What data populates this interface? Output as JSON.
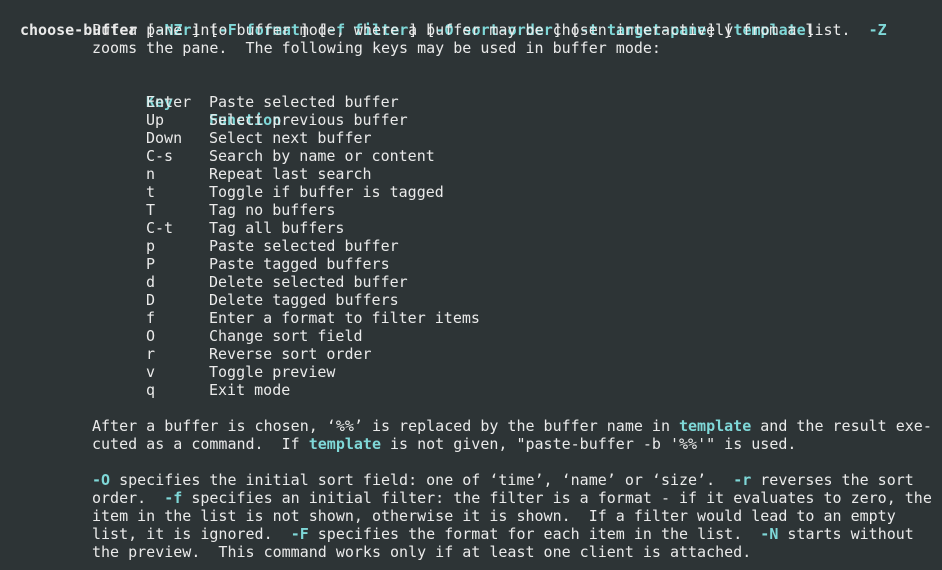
{
  "synopsis": {
    "command": "choose-buffer",
    "b1": " [",
    "flags_nzr": "-NZr",
    "b2": "] [",
    "flag_f": "-F",
    "sp1": " ",
    "arg_format": "format",
    "b3": "] [",
    "flag_f2": "-f",
    "sp2": " ",
    "arg_filter": "filter",
    "b4": "] [",
    "flag_o": "-O",
    "sp3": " ",
    "arg_sort": "sort-order",
    "b5": "] [",
    "flag_t": "-t",
    "sp4": " ",
    "arg_target": "target-pane",
    "b6": "] [",
    "arg_template": "template",
    "b7": "]"
  },
  "intro": {
    "line1_a": "Put a pane into buffer mode, where a buffer may be chosen interactively from a list.  ",
    "line1_z": "-Z",
    "line2": "zooms the pane.  The following keys may be used in buffer mode:"
  },
  "table": {
    "header_key": "Key",
    "header_function": "Function",
    "rows": [
      {
        "key": "Enter",
        "function": "Paste selected buffer"
      },
      {
        "key": "Up",
        "function": "Select previous buffer"
      },
      {
        "key": "Down",
        "function": "Select next buffer"
      },
      {
        "key": "C-s",
        "function": "Search by name or content"
      },
      {
        "key": "n",
        "function": "Repeat last search"
      },
      {
        "key": "t",
        "function": "Toggle if buffer is tagged"
      },
      {
        "key": "T",
        "function": "Tag no buffers"
      },
      {
        "key": "C-t",
        "function": "Tag all buffers"
      },
      {
        "key": "p",
        "function": "Paste selected buffer"
      },
      {
        "key": "P",
        "function": "Paste tagged buffers"
      },
      {
        "key": "d",
        "function": "Delete selected buffer"
      },
      {
        "key": "D",
        "function": "Delete tagged buffers"
      },
      {
        "key": "f",
        "function": "Enter a format to filter items"
      },
      {
        "key": "O",
        "function": "Change sort field"
      },
      {
        "key": "r",
        "function": "Reverse sort order"
      },
      {
        "key": "v",
        "function": "Toggle preview"
      },
      {
        "key": "q",
        "function": "Exit mode"
      }
    ]
  },
  "para1": {
    "l1_a": "After a buffer is chosen, ‘%%’ is replaced by the buffer name in ",
    "l1_template": "template",
    "l1_b": " and the result exe-",
    "l2_a": "cuted as a command.  If ",
    "l2_template": "template",
    "l2_b": " is not given, \"paste-buffer -b '%%'\" is used."
  },
  "para2": {
    "l1_o": "-O",
    "l1_a": " specifies the initial sort field: one of ‘time’, ‘name’ or ‘size’.  ",
    "l1_r": "-r",
    "l1_b": " reverses the sort",
    "l2_a": "order.  ",
    "l2_f": "-f",
    "l2_b": " specifies an initial filter: the filter is a format - if it evaluates to zero, the",
    "l3": "item in the list is not shown, otherwise it is shown.  If a filter would lead to an empty",
    "l4_a": "list, it is ignored.  ",
    "l4_F": "-F",
    "l4_b": " specifies the format for each item in the list.  ",
    "l4_N": "-N",
    "l4_c": " starts without",
    "l5": "the preview.  This command works only if at least one client is attached."
  },
  "colors": {
    "background": "#2d3436",
    "text": "#eaeaea",
    "highlight": "#7fd8d8"
  }
}
